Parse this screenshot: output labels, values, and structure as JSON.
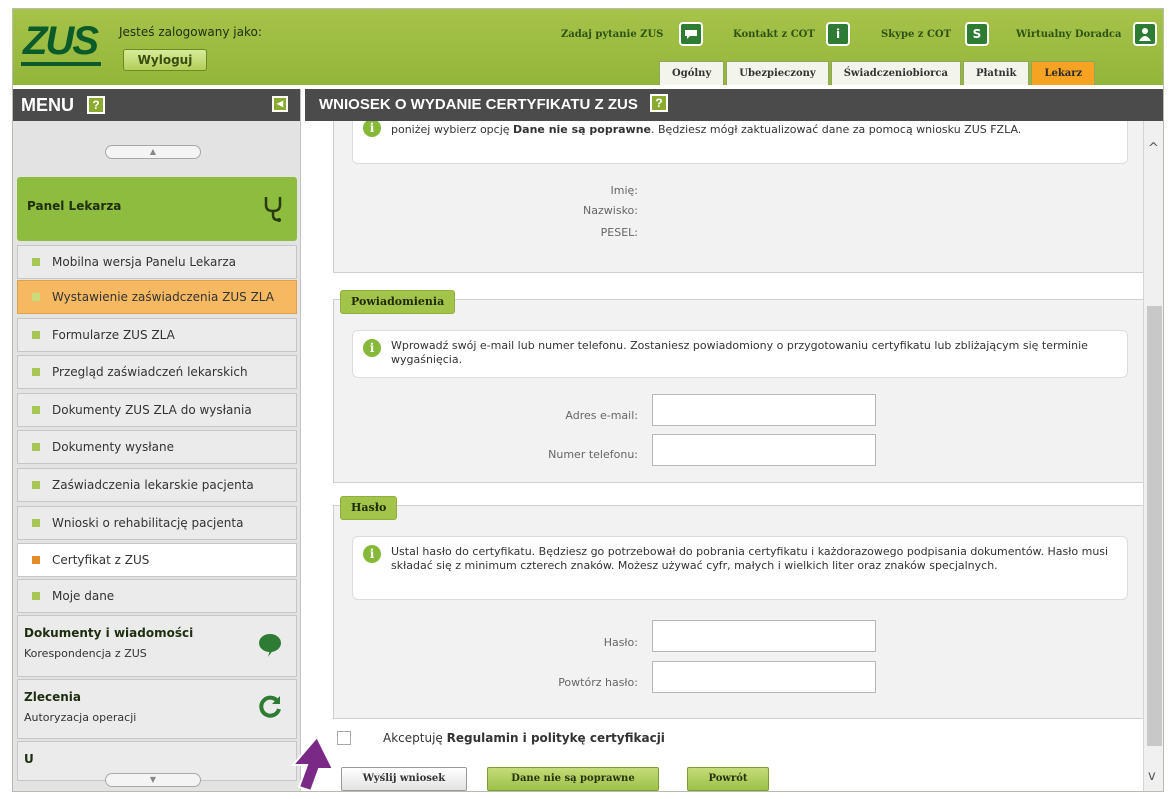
{
  "header": {
    "logo": "ZUS",
    "logged_in_label": "Jesteś zalogowany jako:",
    "logout_label": "Wyloguj",
    "links": [
      {
        "label": "Zadaj pytanie ZUS",
        "icon": "chat-bubble-icon"
      },
      {
        "label": "Kontakt z COT",
        "icon": "info-icon"
      },
      {
        "label": "Skype z COT",
        "icon": "skype-icon"
      },
      {
        "label": "Wirtualny Doradca",
        "icon": "user-icon"
      }
    ],
    "tabs": [
      "Ogólny",
      "Ubezpieczony",
      "Świadczeniobiorca",
      "Płatnik",
      "Lekarz"
    ],
    "active_tab": "Lekarz"
  },
  "sidebar": {
    "menu_title": "MENU",
    "help_mark": "?",
    "panel_title": "Panel Lekarza",
    "scroll_up": "▲",
    "scroll_down": "▼",
    "items": [
      {
        "label": "Mobilna wersja Panelu Lekarza"
      },
      {
        "label": "Wystawienie zaświadczenia ZUS ZLA"
      },
      {
        "label": "Formularze ZUS ZLA"
      },
      {
        "label": "Przegląd zaświadczeń lekarskich"
      },
      {
        "label": "Dokumenty ZUS ZLA do wysłania"
      },
      {
        "label": "Dokumenty wysłane"
      },
      {
        "label": "Zaświadczenia lekarskie pacjenta"
      },
      {
        "label": "Wnioski o rehabilitację pacjenta"
      },
      {
        "label": "Certyfikat z ZUS"
      },
      {
        "label": "Moje dane"
      }
    ],
    "sections": [
      {
        "title": "Dokumenty i wiadomości",
        "sub": "Korespondencja z ZUS",
        "icon": "speech-bubble-icon"
      },
      {
        "title": "Zlecenia",
        "sub": "Autoryzacja operacji",
        "icon": "refresh-icon"
      },
      {
        "title": "U",
        "sub": "",
        "icon": ""
      }
    ],
    "colors": {
      "selected_orange": "#f6b860",
      "current_white": "#ffffff",
      "panel_green": "#8ebc3e"
    }
  },
  "main": {
    "title": "WNIOSEK O WYDANIE CERTYFIKATU Z ZUS",
    "help_mark": "?",
    "top_info": {
      "text_before": "poniżej wybierz opcję ",
      "text_bold": "Dane nie są poprawne",
      "text_after": ". Będziesz mógł zaktualizować dane za pomocą wniosku ZUS FZLA."
    },
    "personal": {
      "imie_label": "Imię:",
      "nazwisko_label": "Nazwisko:",
      "pesel_label": "PESEL:"
    },
    "notifications": {
      "legend": "Powiadomienia",
      "info": "Wprowadź swój e-mail lub numer telefonu. Zostaniesz powiadomiony o przygotowaniu certyfikatu lub zbliżającym się terminie wygaśnięcia.",
      "email_label": "Adres e-mail:",
      "email_value": "",
      "phone_label": "Numer telefonu:",
      "phone_value": ""
    },
    "password": {
      "legend": "Hasło",
      "info": "Ustal hasło do certyfikatu. Będziesz go potrzebował do pobrania certyfikatu i każdorazowego podpisania dokumentów. Hasło musi składać się z minimum czterech znaków. Możesz używać cyfr, małych i wielkich liter oraz znaków specjalnych.",
      "password_label": "Hasło:",
      "password_value": "",
      "repeat_label": "Powtórz hasło:",
      "repeat_value": ""
    },
    "accept": {
      "text_before": "Akceptuję ",
      "text_bold": "Regulamin i politykę certyfikacji",
      "checked": false
    },
    "buttons": {
      "send": "Wyślij wniosek",
      "not_correct": "Dane nie są poprawne",
      "back": "Powrót"
    },
    "scroll_up": "^",
    "scroll_down": "v"
  }
}
